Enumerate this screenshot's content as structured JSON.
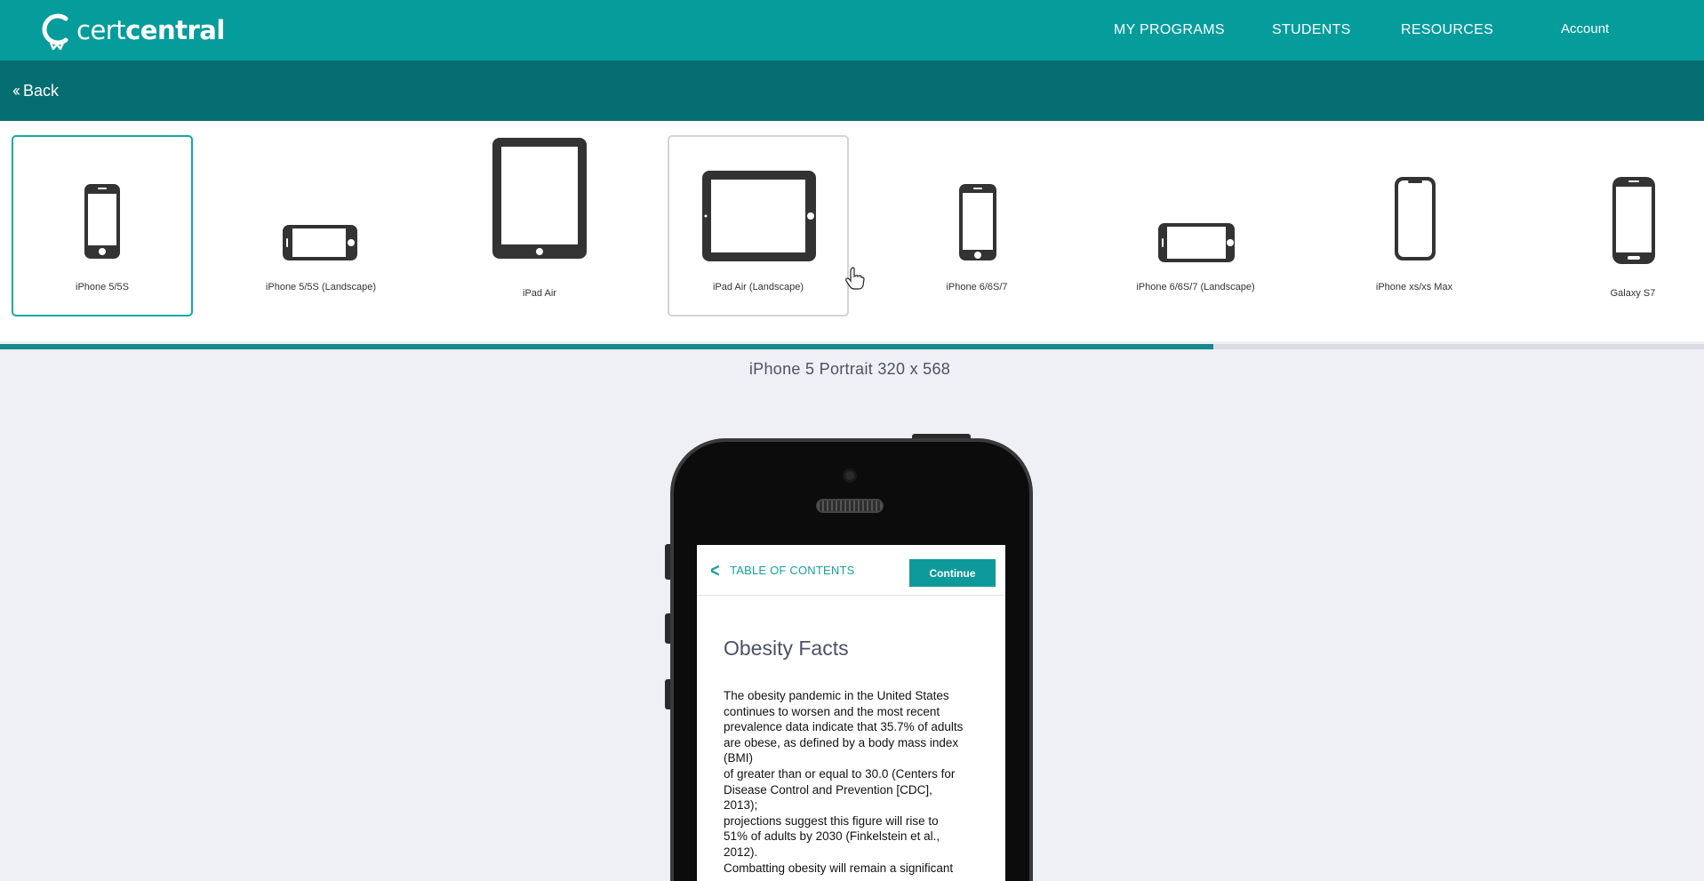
{
  "brand": {
    "logo_light": "cert",
    "logo_bold": "central"
  },
  "nav": {
    "my_programs": "MY PROGRAMS",
    "students": "STUDENTS",
    "resources": "RESOURCES",
    "account": "Account"
  },
  "back": {
    "label": "Back"
  },
  "devices": [
    {
      "label": "iPhone 5/5S",
      "icon": "phone-portrait-icon",
      "state": "selected"
    },
    {
      "label": "iPhone 5/5S (Landscape)",
      "icon": "phone-landscape-icon"
    },
    {
      "label": "iPad Air",
      "icon": "tablet-portrait-icon"
    },
    {
      "label": "iPad Air (Landscape)",
      "icon": "tablet-landscape-icon",
      "state": "hovered"
    },
    {
      "label": "iPhone 6/6S/7",
      "icon": "phone-portrait-icon"
    },
    {
      "label": "iPhone 6/6S/7 (Landscape)",
      "icon": "phone-landscape-icon"
    },
    {
      "label": "iPhone xs/xs Max",
      "icon": "phone-notch-icon"
    },
    {
      "label": "Galaxy S7",
      "icon": "phone-portrait-icon"
    }
  ],
  "device_scroll": {
    "progress": 0.712
  },
  "preview": {
    "title": "iPhone 5 Portrait 320 x 568"
  },
  "screen": {
    "toc_label": "TABLE OF CONTENTS",
    "continue_label": "Continue",
    "article_title": "Obesity Facts",
    "article_lines": [
      "The obesity pandemic in the United States",
      "continues to worsen and the most recent",
      "prevalence data indicate that 35.7% of adults",
      "are obese, as defined by a body mass index",
      "(BMI)",
      "of greater than or equal to 30.0 (Centers for",
      "Disease Control and Prevention [CDC],",
      "2013);",
      "projections suggest this figure will rise to",
      "51% of adults by 2030 (Finkelstein et al.,",
      "2012).",
      "Combatting obesity will remain a significant"
    ]
  },
  "colors": {
    "topbar": "#069c9c",
    "backbar": "#046d72",
    "accent": "#14a7a7",
    "progress": "#15898b"
  }
}
